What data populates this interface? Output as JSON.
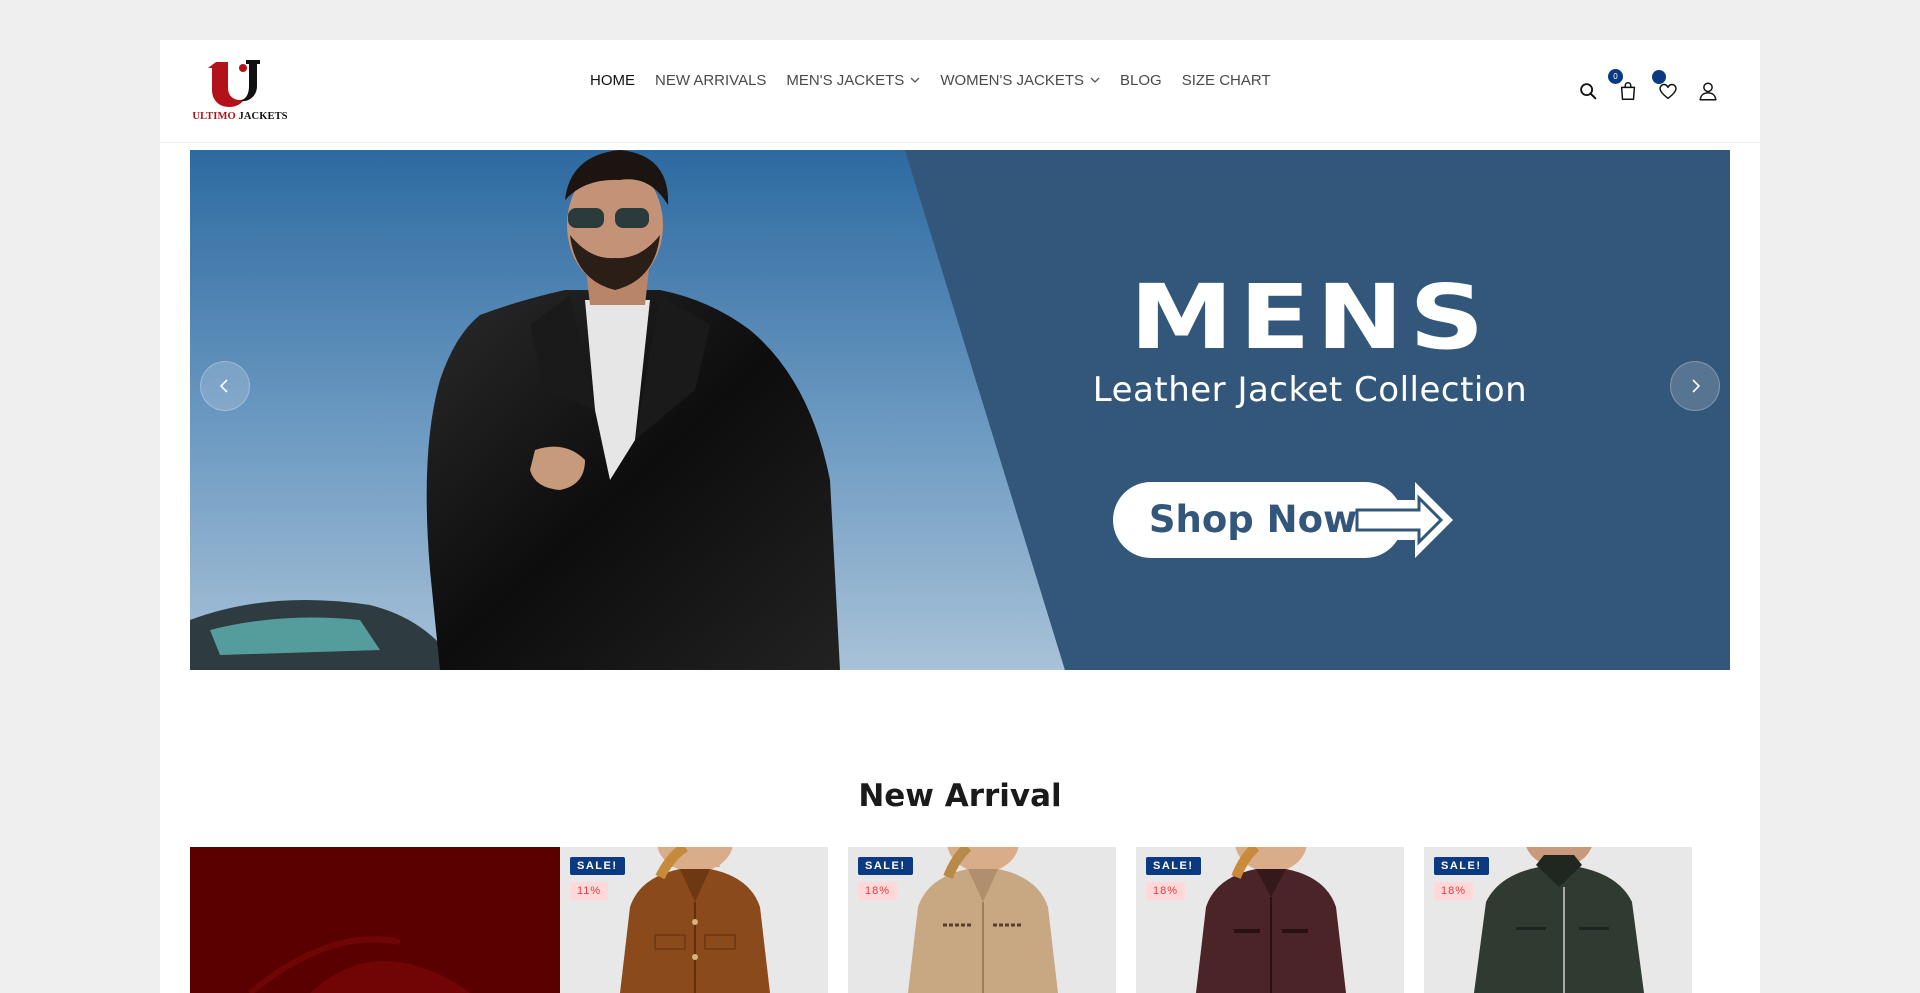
{
  "brand": {
    "logo_red": "ULTIMO",
    "logo_black": "JACKETS",
    "colors": {
      "red": "#b3121a",
      "accent": "#0b3a82"
    }
  },
  "nav": {
    "items": [
      {
        "label": "HOME",
        "active": true,
        "dropdown": false
      },
      {
        "label": "NEW ARRIVALS",
        "active": false,
        "dropdown": false
      },
      {
        "label": "MEN'S JACKETS",
        "active": false,
        "dropdown": true
      },
      {
        "label": "WOMEN'S JACKETS",
        "active": false,
        "dropdown": true
      },
      {
        "label": "BLOG",
        "active": false,
        "dropdown": false
      },
      {
        "label": "SIZE CHART",
        "active": false,
        "dropdown": false
      }
    ]
  },
  "header_icons": {
    "search": "search-icon",
    "cart": "cart-icon",
    "cart_count": "0",
    "wishlist": "heart-icon",
    "account": "user-icon"
  },
  "hero": {
    "title": "MENS",
    "subtitle": "Leather Jacket Collection",
    "cta": "Shop Now",
    "bg_color": "#33577a"
  },
  "new_arrival": {
    "title": "New Arrival",
    "products": [
      {
        "sale": "SALE!",
        "discount": "11%",
        "color": "#8a4a1c"
      },
      {
        "sale": "SALE!",
        "discount": "18%",
        "color": "#c8a783"
      },
      {
        "sale": "SALE!",
        "discount": "18%",
        "color": "#4a2426"
      },
      {
        "sale": "SALE!",
        "discount": "18%",
        "color": "#2f3a30"
      }
    ]
  }
}
